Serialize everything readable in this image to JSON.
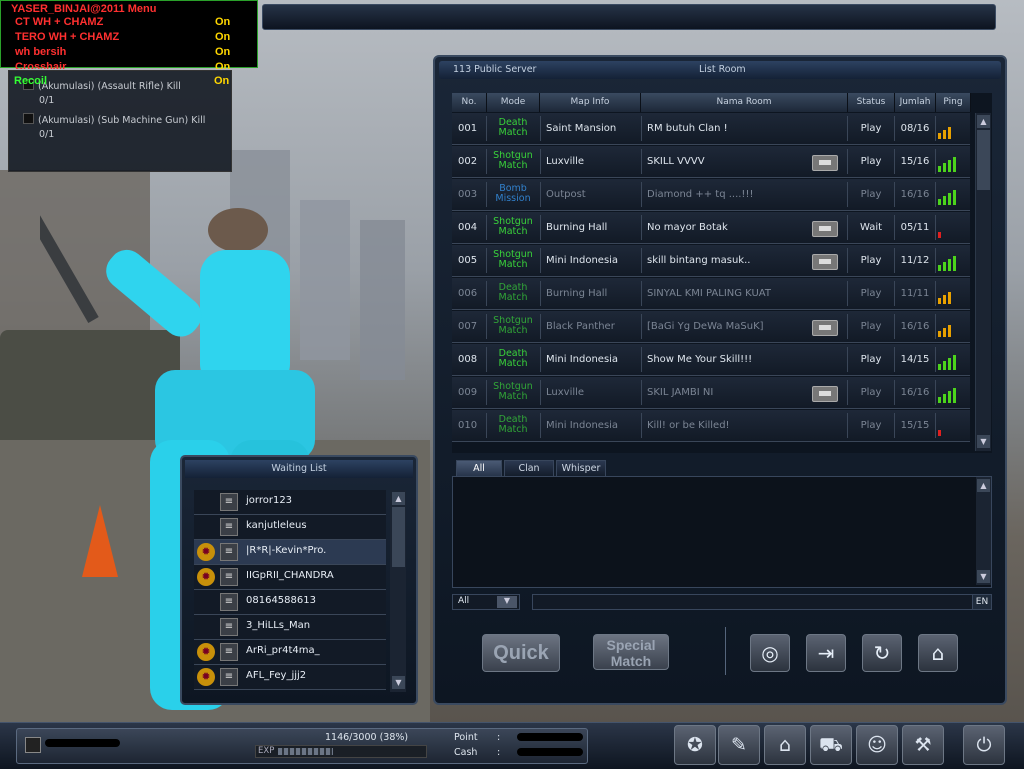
{
  "cheat_menu": {
    "title": "YASER_BINJAI@2011 Menu",
    "items": [
      {
        "label": "CT WH + CHAMZ",
        "value": "On"
      },
      {
        "label": "TERO WH + CHAMZ",
        "value": "On"
      },
      {
        "label": "wh bersih",
        "value": "On"
      },
      {
        "label": "Crosshair",
        "value": "On"
      },
      {
        "label": "Recoil",
        "value": "On"
      }
    ]
  },
  "missions": [
    {
      "label": "(Akumulasi) (Assault Rifle) Kill",
      "count": "0/1"
    },
    {
      "label": "(Akumulasi) (Sub Machine Gun) Kill",
      "count": "0/1"
    }
  ],
  "room_panel": {
    "server": "113 Public Server",
    "title": "List Room",
    "columns": [
      "No.",
      "Mode",
      "Map Info",
      "Nama Room",
      "Status",
      "Jumlah",
      "Ping"
    ],
    "rooms": [
      {
        "no": "001",
        "mode1": "Death",
        "mode2": "Match",
        "mode_color": "#39d23a",
        "map": "Saint Mansion",
        "name": "RM butuh Clan !",
        "status": "Play",
        "count": "08/16",
        "ping": 3,
        "ping_color": "#e8a100",
        "locked": false,
        "dim": false
      },
      {
        "no": "002",
        "mode1": "Shotgun",
        "mode2": "Match",
        "mode_color": "#39d23a",
        "map": "Luxville",
        "name": "SKILL VVVV",
        "status": "Play",
        "count": "15/16",
        "ping": 4,
        "ping_color": "#4cd41c",
        "locked": true,
        "dim": false
      },
      {
        "no": "003",
        "mode1": "Bomb",
        "mode2": "Mission",
        "mode_color": "#3aa0ff",
        "map": "Outpost",
        "name": "Diamond ++ tq ....!!!",
        "status": "Play",
        "count": "16/16",
        "ping": 4,
        "ping_color": "#4cd41c",
        "locked": false,
        "dim": true
      },
      {
        "no": "004",
        "mode1": "Shotgun",
        "mode2": "Match",
        "mode_color": "#39d23a",
        "map": "Burning Hall",
        "name": "No mayor Botak",
        "status": "Wait",
        "count": "05/11",
        "ping": 1,
        "ping_color": "#e02020",
        "locked": true,
        "dim": false
      },
      {
        "no": "005",
        "mode1": "Shotgun",
        "mode2": "Match",
        "mode_color": "#39d23a",
        "map": "Mini Indonesia",
        "name": "skill bintang masuk..",
        "status": "Play",
        "count": "11/12",
        "ping": 4,
        "ping_color": "#4cd41c",
        "locked": true,
        "dim": false
      },
      {
        "no": "006",
        "mode1": "Death",
        "mode2": "Match",
        "mode_color": "#39d23a",
        "map": "Burning Hall",
        "name": "SINYAL KMI PALING KUAT",
        "status": "Play",
        "count": "11/11",
        "ping": 3,
        "ping_color": "#e8a100",
        "locked": false,
        "dim": true
      },
      {
        "no": "007",
        "mode1": "Shotgun",
        "mode2": "Match",
        "mode_color": "#39d23a",
        "map": "Black Panther",
        "name": "[BaGi Yg DeWa MaSuK]",
        "status": "Play",
        "count": "16/16",
        "ping": 3,
        "ping_color": "#e8a100",
        "locked": true,
        "dim": true
      },
      {
        "no": "008",
        "mode1": "Death",
        "mode2": "Match",
        "mode_color": "#39d23a",
        "map": "Mini Indonesia",
        "name": "Show Me Your Skill!!!",
        "status": "Play",
        "count": "14/15",
        "ping": 4,
        "ping_color": "#4cd41c",
        "locked": false,
        "dim": false
      },
      {
        "no": "009",
        "mode1": "Shotgun",
        "mode2": "Match",
        "mode_color": "#39d23a",
        "map": "Luxville",
        "name": "SKIL JAMBI NI",
        "status": "Play",
        "count": "16/16",
        "ping": 4,
        "ping_color": "#4cd41c",
        "locked": true,
        "dim": true
      },
      {
        "no": "010",
        "mode1": "Death",
        "mode2": "Match",
        "mode_color": "#39d23a",
        "map": "Mini Indonesia",
        "name": "Kill! or be Killed!",
        "status": "Play",
        "count": "15/15",
        "ping": 1,
        "ping_color": "#e02020",
        "locked": false,
        "dim": true
      }
    ]
  },
  "chat": {
    "tabs": [
      "All",
      "Clan",
      "Whisper"
    ],
    "channel": "All",
    "lang": "EN"
  },
  "buttons": {
    "quick": "Quick",
    "special1": "Special",
    "special2": "Match"
  },
  "waiting_list": {
    "title": "Waiting List",
    "players": [
      {
        "name": "jorror123",
        "clan": false,
        "selected": false
      },
      {
        "name": "kanjutleleus",
        "clan": false,
        "selected": false
      },
      {
        "name": "|R*R|-Kevin*Pro.",
        "clan": true,
        "selected": true
      },
      {
        "name": "IIGpRII_CHANDRA",
        "clan": true,
        "selected": false
      },
      {
        "name": "08164588613",
        "clan": false,
        "selected": false
      },
      {
        "name": "3_HiLLs_Man",
        "clan": false,
        "selected": false
      },
      {
        "name": "ArRi_pr4t4ma_",
        "clan": true,
        "selected": false
      },
      {
        "name": "AFL_Fey_jjj2",
        "clan": true,
        "selected": false
      }
    ]
  },
  "user_bar": {
    "exp_text": "1146/3000 (38%)",
    "exp_label": "EXP",
    "exp_fraction": 0.38,
    "point_label": "Point",
    "cash_label": "Cash",
    "colon": ":"
  }
}
